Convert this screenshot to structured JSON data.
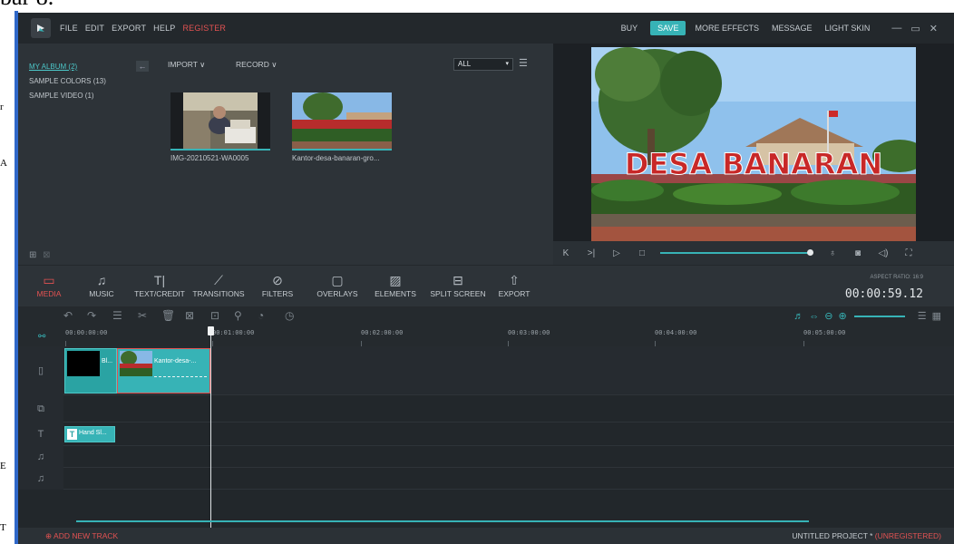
{
  "document_bg": {
    "top_text": "bar 8.",
    "side_letters": [
      "r",
      "A",
      "E",
      "T"
    ]
  },
  "app": {
    "menu": {
      "file": "FILE",
      "edit": "EDIT",
      "export": "EXPORT",
      "help": "HELP",
      "register": "REGISTER"
    },
    "topright": {
      "buy": "BUY",
      "save": "SAVE",
      "more_effects": "MORE EFFECTS",
      "message": "MESSAGE",
      "light_skin": "LIGHT SKIN"
    },
    "library": {
      "albums": [
        {
          "label": "MY ALBUM (2)",
          "active": true
        },
        {
          "label": "SAMPLE COLORS (13)",
          "active": false
        },
        {
          "label": "SAMPLE VIDEO (1)",
          "active": false
        }
      ],
      "back_label": "←",
      "import_label": "IMPORT ∨",
      "record_label": "RECORD ∨",
      "filter_value": "ALL",
      "items": [
        {
          "caption": "IMG-20210521-WA0005"
        },
        {
          "caption": "Kantor-desa-banaran-gro..."
        }
      ]
    },
    "preview": {
      "sign_text": "DESA BANARAN"
    },
    "toolbar": {
      "tabs": [
        {
          "label": "MEDIA",
          "icon": "folder-icon",
          "active": true
        },
        {
          "label": "MUSIC",
          "icon": "music-icon",
          "active": false
        },
        {
          "label": "TEXT/CREDIT",
          "icon": "text-icon",
          "active": false
        },
        {
          "label": "TRANSITIONS",
          "icon": "transition-icon",
          "active": false
        },
        {
          "label": "FILTERS",
          "icon": "filter-icon",
          "active": false
        },
        {
          "label": "OVERLAYS",
          "icon": "overlay-icon",
          "active": false
        },
        {
          "label": "ELEMENTS",
          "icon": "image-icon",
          "active": false
        },
        {
          "label": "SPLIT SCREEN",
          "icon": "split-screen-icon",
          "active": false
        },
        {
          "label": "EXPORT",
          "icon": "export-icon",
          "active": false
        }
      ],
      "aspect_ratio": "ASPECT RATIO: 16:9",
      "timecode": "00:00:59.12"
    },
    "ruler": {
      "ticks": [
        "00:00:00:00",
        "00:01:00:00",
        "00:02:00:00",
        "00:03:00:00",
        "00:04:00:00",
        "00:05:00:00"
      ]
    },
    "clips": {
      "video1_label": "Bl...",
      "video2_label": "Kantor-desa-...",
      "text_label": "Hand Sl..."
    },
    "footer": {
      "add_track": "ADD NEW TRACK",
      "project": "UNTITLED PROJECT *",
      "unregistered": "(UNREGISTERED)"
    },
    "colors": {
      "accent": "#37b3b6",
      "active_red": "#e25252",
      "bg": "#2b3136"
    }
  }
}
